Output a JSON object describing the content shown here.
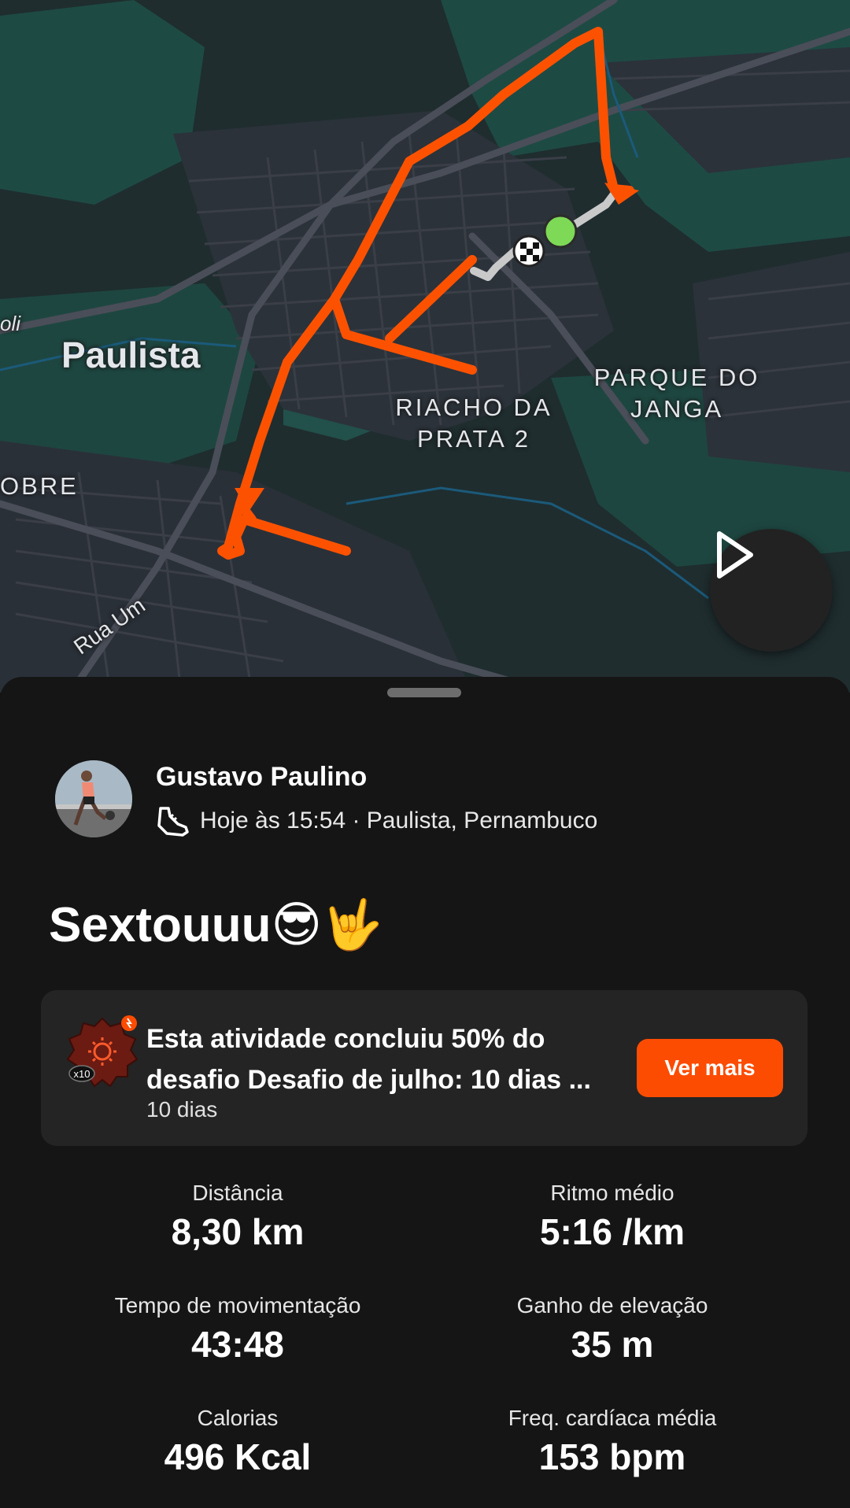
{
  "map": {
    "labels": {
      "paulista": "Paulista",
      "parque_do_janga_1": "PARQUE DO",
      "parque_do_janga_2": "JANGA",
      "riacho_da_prata_1": "RIACHO DA",
      "riacho_da_prata_2": "PRATA 2",
      "obre": "OBRE",
      "rua_um": "Rua Um",
      "oli": "oli"
    },
    "colors": {
      "route": "#fc5200",
      "start": "#7ed957",
      "land": "#1e3a3b",
      "roads": "#3a3d45"
    }
  },
  "controls": {
    "play_icon": "play-icon"
  },
  "athlete": {
    "name": "Gustavo Paulino",
    "meta": "Hoje às 15:54 · Paulista, Pernambuco",
    "sport_icon": "running-shoe-icon"
  },
  "activity": {
    "title": "Sextouuu😎🤟"
  },
  "challenge": {
    "text_line1": "Esta atividade concluiu 50% do",
    "text_line2": "desafio Desafio de julho: 10 dias ...",
    "subtitle": "10 dias",
    "badge_label": "x10",
    "button_label": "Ver mais"
  },
  "stats": [
    {
      "label": "Distância",
      "value": "8,30 km"
    },
    {
      "label": "Ritmo médio",
      "value": "5:16 /km"
    },
    {
      "label": "Tempo de movimentação",
      "value": "43:48"
    },
    {
      "label": "Ganho de elevação",
      "value": "35 m"
    },
    {
      "label": "Calorias",
      "value": "496 Kcal"
    },
    {
      "label": "Freq. cardíaca média",
      "value": "153 bpm"
    }
  ]
}
